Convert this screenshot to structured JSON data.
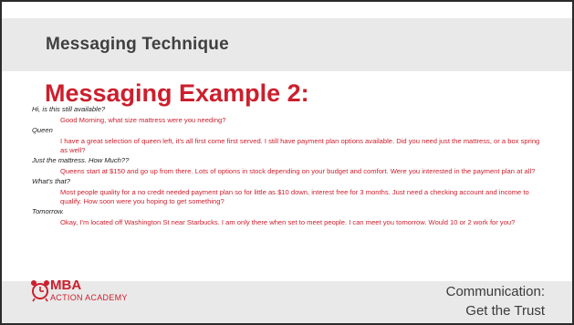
{
  "slide": {
    "section_title": "Messaging Technique",
    "example_title": "Messaging Example 2:",
    "messages": [
      {
        "role": "customer",
        "text": "Hi, is this still available?"
      },
      {
        "role": "seller",
        "text": "Good Morning, what size mattress were you needing?"
      },
      {
        "role": "customer",
        "text": "Queen"
      },
      {
        "role": "seller",
        "text": "I have a great selection of queen left, it's all first come first served. I still have payment plan options available. Did you need just the mattress, or a box spring as well?"
      },
      {
        "role": "customer",
        "text": "Just the mattress. How Much??"
      },
      {
        "role": "seller",
        "text": "Queens start at $150 and go up from there. Lots of options in stock depending on your budget and comfort. Were you interested in the payment plan at all?"
      },
      {
        "role": "customer",
        "text": "What's that?"
      },
      {
        "role": "seller",
        "text": "Most people quality for a no credit needed payment plan so for little as $10 down, interest free for 3 months. Just need a checking account and income to qualify. How soon were you hoping to get something?"
      },
      {
        "role": "customer",
        "text": "Tomorrow."
      },
      {
        "role": "seller",
        "text": "Okay, I'm located off Washington St near Starbucks. I am only there when set to meet people. I can meet you tomorrow. Would 10 or 2 work for you?"
      }
    ],
    "logo": {
      "brand": "MBA",
      "subtitle": "ACTION ACADEMY"
    },
    "tagline": {
      "line1": "Communication:",
      "line2": "Get the Trust"
    },
    "colors": {
      "accent": "#cc1f2d",
      "band": "#e9e9e9",
      "text": "#404040"
    }
  }
}
